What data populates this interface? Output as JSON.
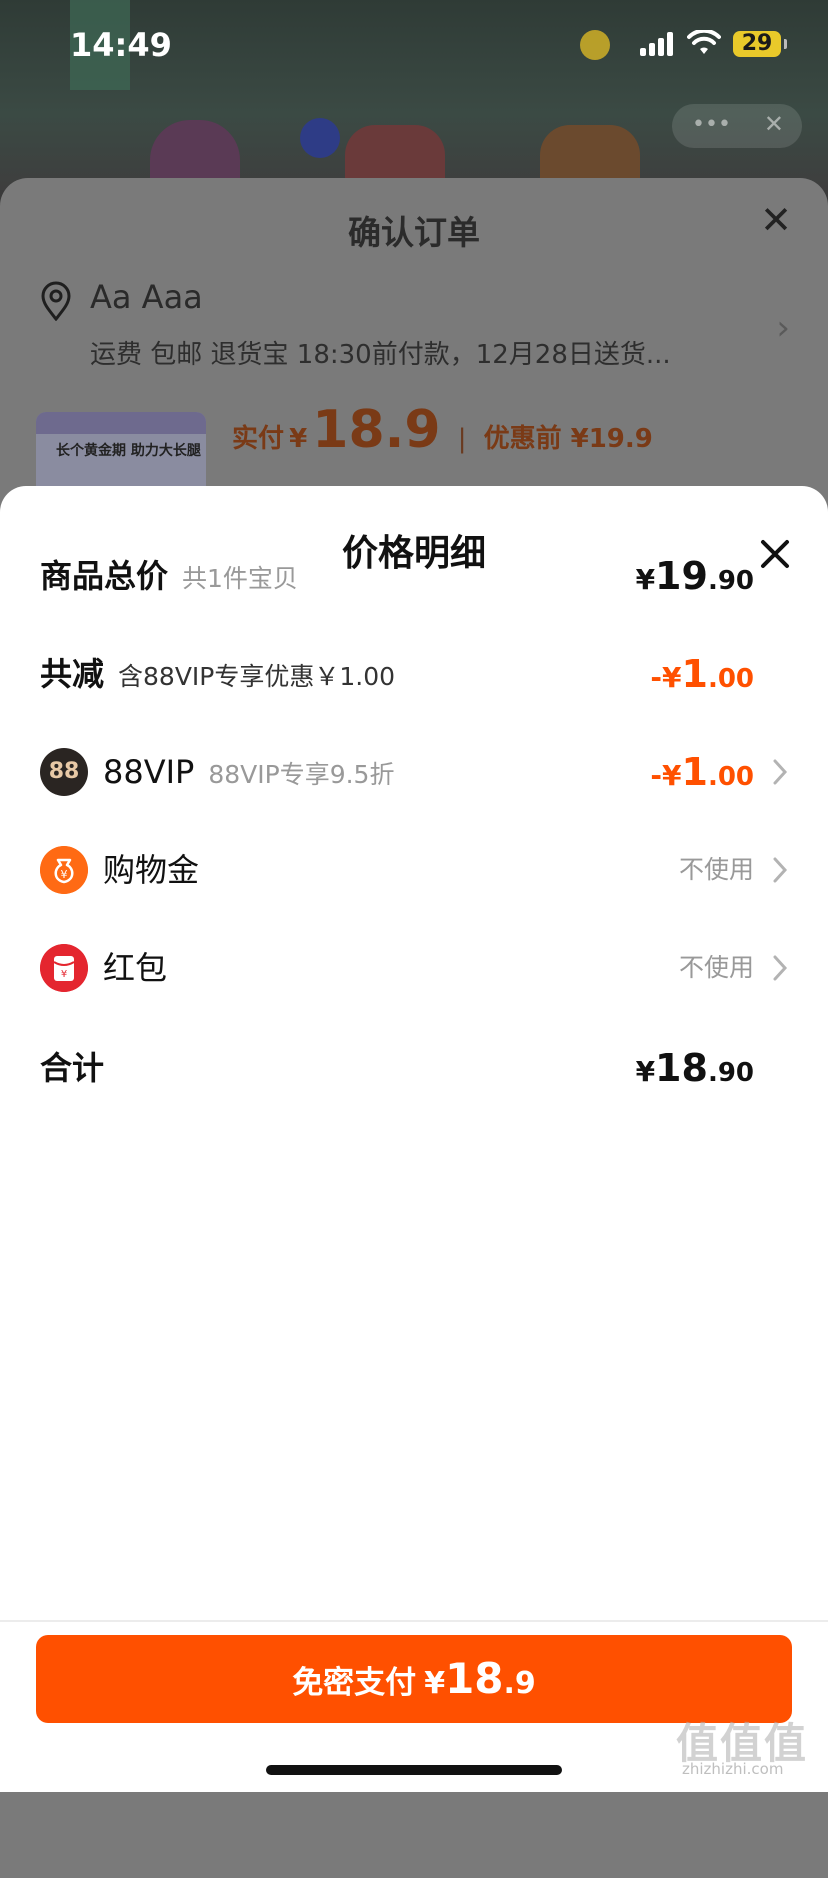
{
  "status_bar": {
    "time": "14:49",
    "battery": "29"
  },
  "order": {
    "title": "确认订单",
    "address_name": "Aa Aaa",
    "address_detail": "运费 包邮 退货宝 18:30前付款，12月28日送货...",
    "product_banner": "长个黄金期 助力大长腿",
    "paid_label": "实付",
    "paid_currency": "¥",
    "paid_amount": "18.9",
    "before_label": "优惠前 ¥19.9"
  },
  "price_detail": {
    "title": "价格明细",
    "rows": [
      {
        "label": "商品总价",
        "sub": "共1件宝贝",
        "currency": "¥",
        "int": "19",
        "dec": ".90"
      },
      {
        "label": "共减",
        "sub": "含88VIP专享优惠￥1.00",
        "currency": "-¥",
        "int": "1",
        "dec": ".00"
      },
      {
        "label": "88VIP",
        "sub": "88VIP专享9.5折",
        "currency": "-¥",
        "int": "1",
        "dec": ".00",
        "icon_text": "88"
      },
      {
        "label": "购物金",
        "value": "不使用"
      },
      {
        "label": "红包",
        "value": "不使用"
      },
      {
        "label": "合计",
        "currency": "¥",
        "int": "18",
        "dec": ".90"
      }
    ]
  },
  "pay_button": {
    "label": "免密支付",
    "currency": "¥",
    "int": "18",
    "dec": ".9"
  },
  "watermark": {
    "text": "值值值",
    "sub": "zhizhizhi.com"
  },
  "colors": {
    "accent": "#ff5000",
    "sheet_bg": "#ffffff",
    "dim": "#7a7a7a"
  }
}
